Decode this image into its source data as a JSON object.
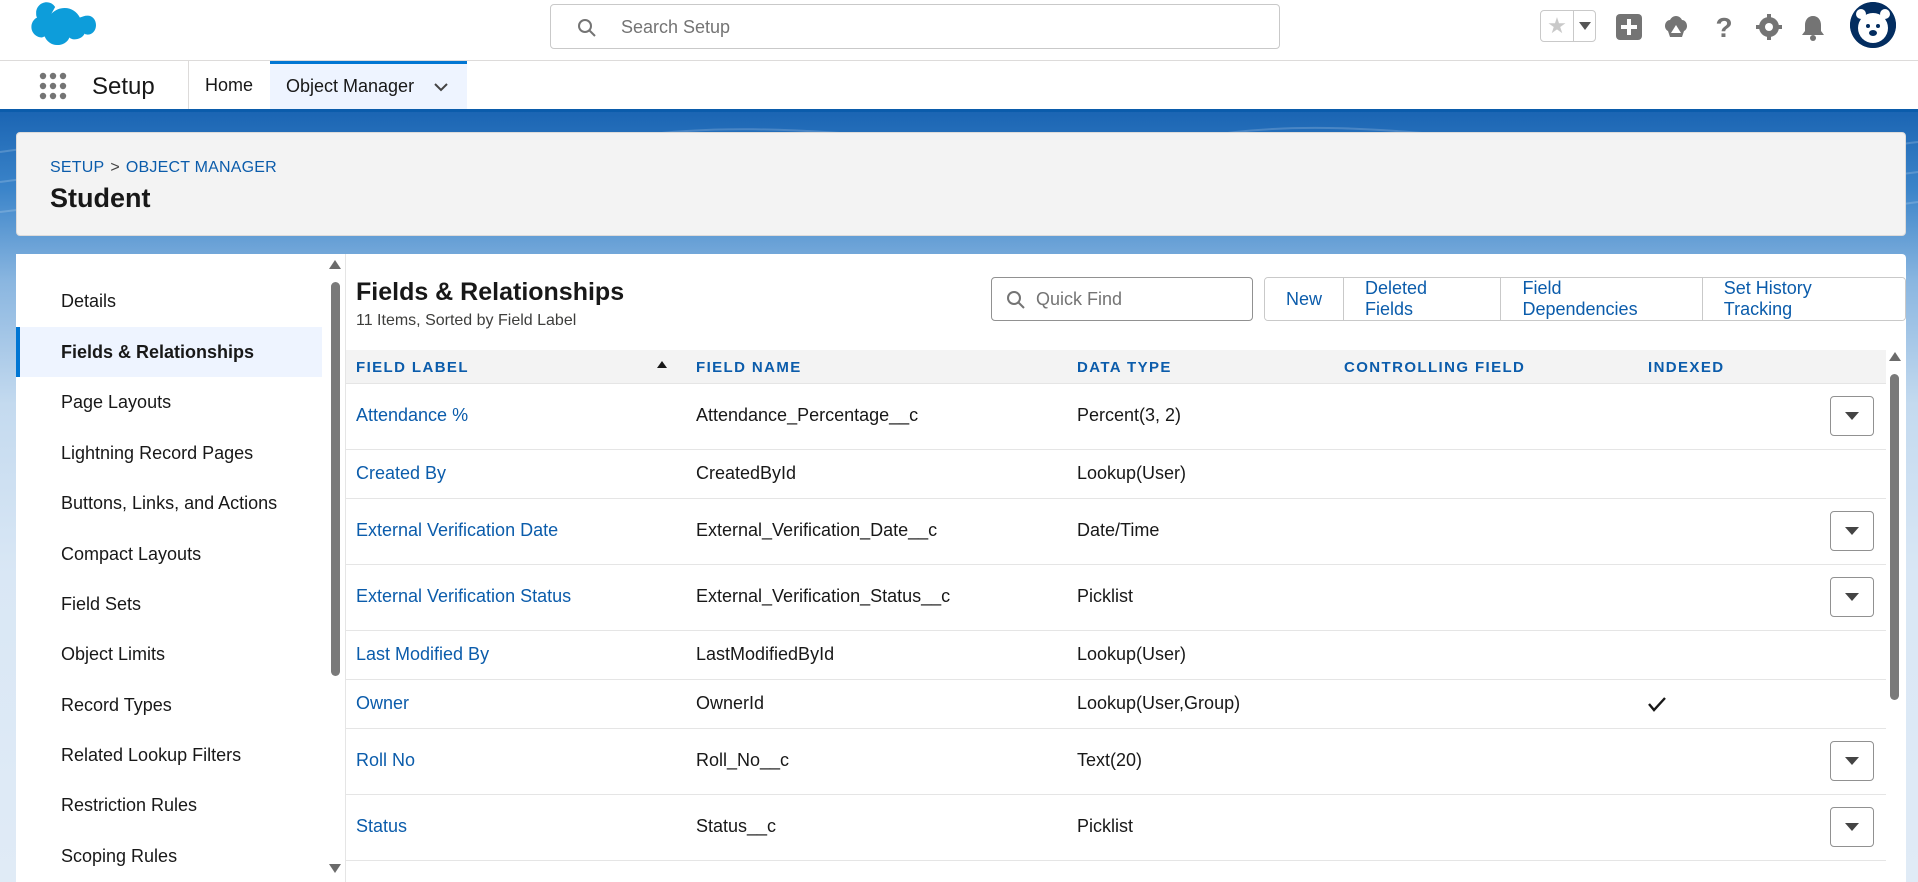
{
  "global_header": {
    "logo_icon": "salesforce-cloud-logo",
    "search_placeholder": "Search Setup",
    "icons": [
      "star-icon",
      "add-icon",
      "trailhead-icon",
      "help-icon",
      "gear-icon",
      "bell-icon",
      "avatar"
    ]
  },
  "context_bar": {
    "app_name": "Setup",
    "tabs": [
      {
        "label": "Home"
      },
      {
        "label": "Object Manager"
      }
    ]
  },
  "page_header": {
    "breadcrumb": [
      "SETUP",
      "OBJECT MANAGER"
    ],
    "breadcrumb_separator": ">",
    "title": "Student"
  },
  "sidebar": {
    "items": [
      {
        "label": "Details"
      },
      {
        "label": "Fields & Relationships"
      },
      {
        "label": "Page Layouts"
      },
      {
        "label": "Lightning Record Pages"
      },
      {
        "label": "Buttons, Links, and Actions"
      },
      {
        "label": "Compact Layouts"
      },
      {
        "label": "Field Sets"
      },
      {
        "label": "Object Limits"
      },
      {
        "label": "Record Types"
      },
      {
        "label": "Related Lookup Filters"
      },
      {
        "label": "Restriction Rules"
      },
      {
        "label": "Scoping Rules"
      }
    ],
    "active_index": 1
  },
  "main": {
    "section_title": "Fields & Relationships",
    "subtitle": "11 Items, Sorted by Field Label",
    "quick_find_placeholder": "Quick Find",
    "buttons": [
      "New",
      "Deleted Fields",
      "Field Dependencies",
      "Set History Tracking"
    ],
    "columns": [
      "FIELD LABEL",
      "FIELD NAME",
      "DATA TYPE",
      "CONTROLLING FIELD",
      "INDEXED"
    ],
    "rows": [
      {
        "label": "Attendance %",
        "name": "Attendance_Percentage__c",
        "type": "Percent(3, 2)",
        "controlling": "",
        "indexed": false,
        "has_action": true
      },
      {
        "label": "Created By",
        "name": "CreatedById",
        "type": "Lookup(User)",
        "controlling": "",
        "indexed": false,
        "has_action": false
      },
      {
        "label": "External Verification Date",
        "name": "External_Verification_Date__c",
        "type": "Date/Time",
        "controlling": "",
        "indexed": false,
        "has_action": true
      },
      {
        "label": "External Verification Status",
        "name": "External_Verification_Status__c",
        "type": "Picklist",
        "controlling": "",
        "indexed": false,
        "has_action": true
      },
      {
        "label": "Last Modified By",
        "name": "LastModifiedById",
        "type": "Lookup(User)",
        "controlling": "",
        "indexed": false,
        "has_action": false
      },
      {
        "label": "Owner",
        "name": "OwnerId",
        "type": "Lookup(User,Group)",
        "controlling": "",
        "indexed": true,
        "has_action": false
      },
      {
        "label": "Roll No",
        "name": "Roll_No__c",
        "type": "Text(20)",
        "controlling": "",
        "indexed": false,
        "has_action": true
      },
      {
        "label": "Status",
        "name": "Status__c",
        "type": "Picklist",
        "controlling": "",
        "indexed": false,
        "has_action": true
      }
    ]
  },
  "colors": {
    "brand_blue": "#0176d3",
    "link_blue": "#0b5cab",
    "header_bg": "#1b65b3"
  }
}
